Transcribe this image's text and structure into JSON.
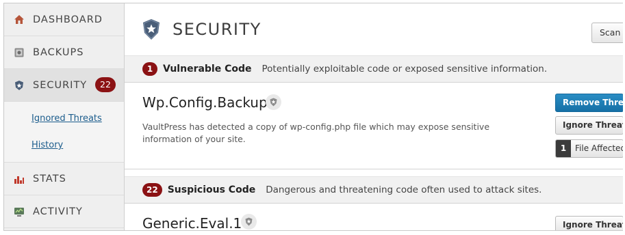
{
  "sidebar": {
    "items": [
      {
        "label": "DASHBOARD",
        "icon": "house-icon"
      },
      {
        "label": "BACKUPS",
        "icon": "vault-icon"
      },
      {
        "label": "SECURITY",
        "icon": "shield-icon",
        "badge": "22",
        "active": true
      },
      {
        "label": "STATS",
        "icon": "bar-chart-icon"
      },
      {
        "label": "ACTIVITY",
        "icon": "monitor-icon"
      }
    ],
    "subitems": [
      {
        "label": "Ignored Threats"
      },
      {
        "label": "History"
      }
    ]
  },
  "header": {
    "title": "SECURITY",
    "scan_label": "Scan"
  },
  "sections": [
    {
      "count": "1",
      "title": "Vulnerable Code",
      "description": "Potentially exploitable code or exposed sensitive information.",
      "threats": [
        {
          "name": "Wp.Config.Backup",
          "description": "VaultPress has detected a copy of wp-config.php file which may expose sensitive information of your site.",
          "remove_label": "Remove Threat",
          "ignore_label": "Ignore Threat",
          "files_count": "1",
          "files_label": "File Affected"
        }
      ]
    },
    {
      "count": "22",
      "title": "Suspicious Code",
      "description": "Dangerous and threatening code often used to attack sites.",
      "threats": [
        {
          "name": "Generic.Eval.1",
          "ignore_label": "Ignore Threat"
        }
      ]
    }
  ],
  "colors": {
    "badge": "#8b1214",
    "primary_button": "#1a7bb5",
    "link": "#1b5c8c"
  }
}
